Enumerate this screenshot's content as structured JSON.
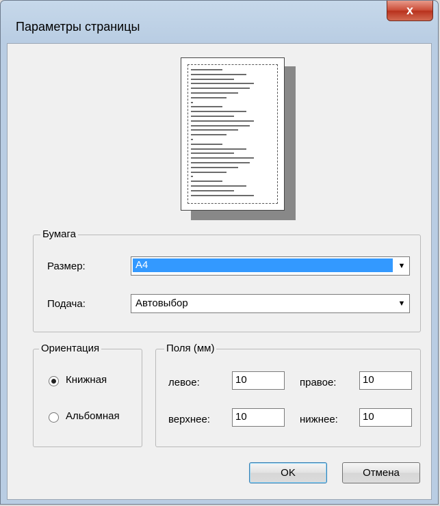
{
  "window": {
    "title": "Параметры страницы",
    "close_label": "x"
  },
  "paper": {
    "legend": "Бумага",
    "size_label": "Размер:",
    "size_value": "A4",
    "source_label": "Подача:",
    "source_value": "Автовыбор"
  },
  "orientation": {
    "legend": "Ориентация",
    "portrait_label": "Книжная",
    "landscape_label": "Альбомная",
    "selected": "portrait"
  },
  "margins": {
    "legend": "Поля (мм)",
    "left_label": "левое:",
    "left_value": "10",
    "right_label": "правое:",
    "right_value": "10",
    "top_label": "верхнее:",
    "top_value": "10",
    "bottom_label": "нижнее:",
    "bottom_value": "10"
  },
  "buttons": {
    "ok": "OK",
    "cancel": "Отмена"
  },
  "icons": {
    "dropdown": "chevron-down-icon",
    "close": "close-icon"
  },
  "colors": {
    "selection": "#3399ff",
    "close_button": "#c94a35",
    "frame": "#b9cde3"
  }
}
